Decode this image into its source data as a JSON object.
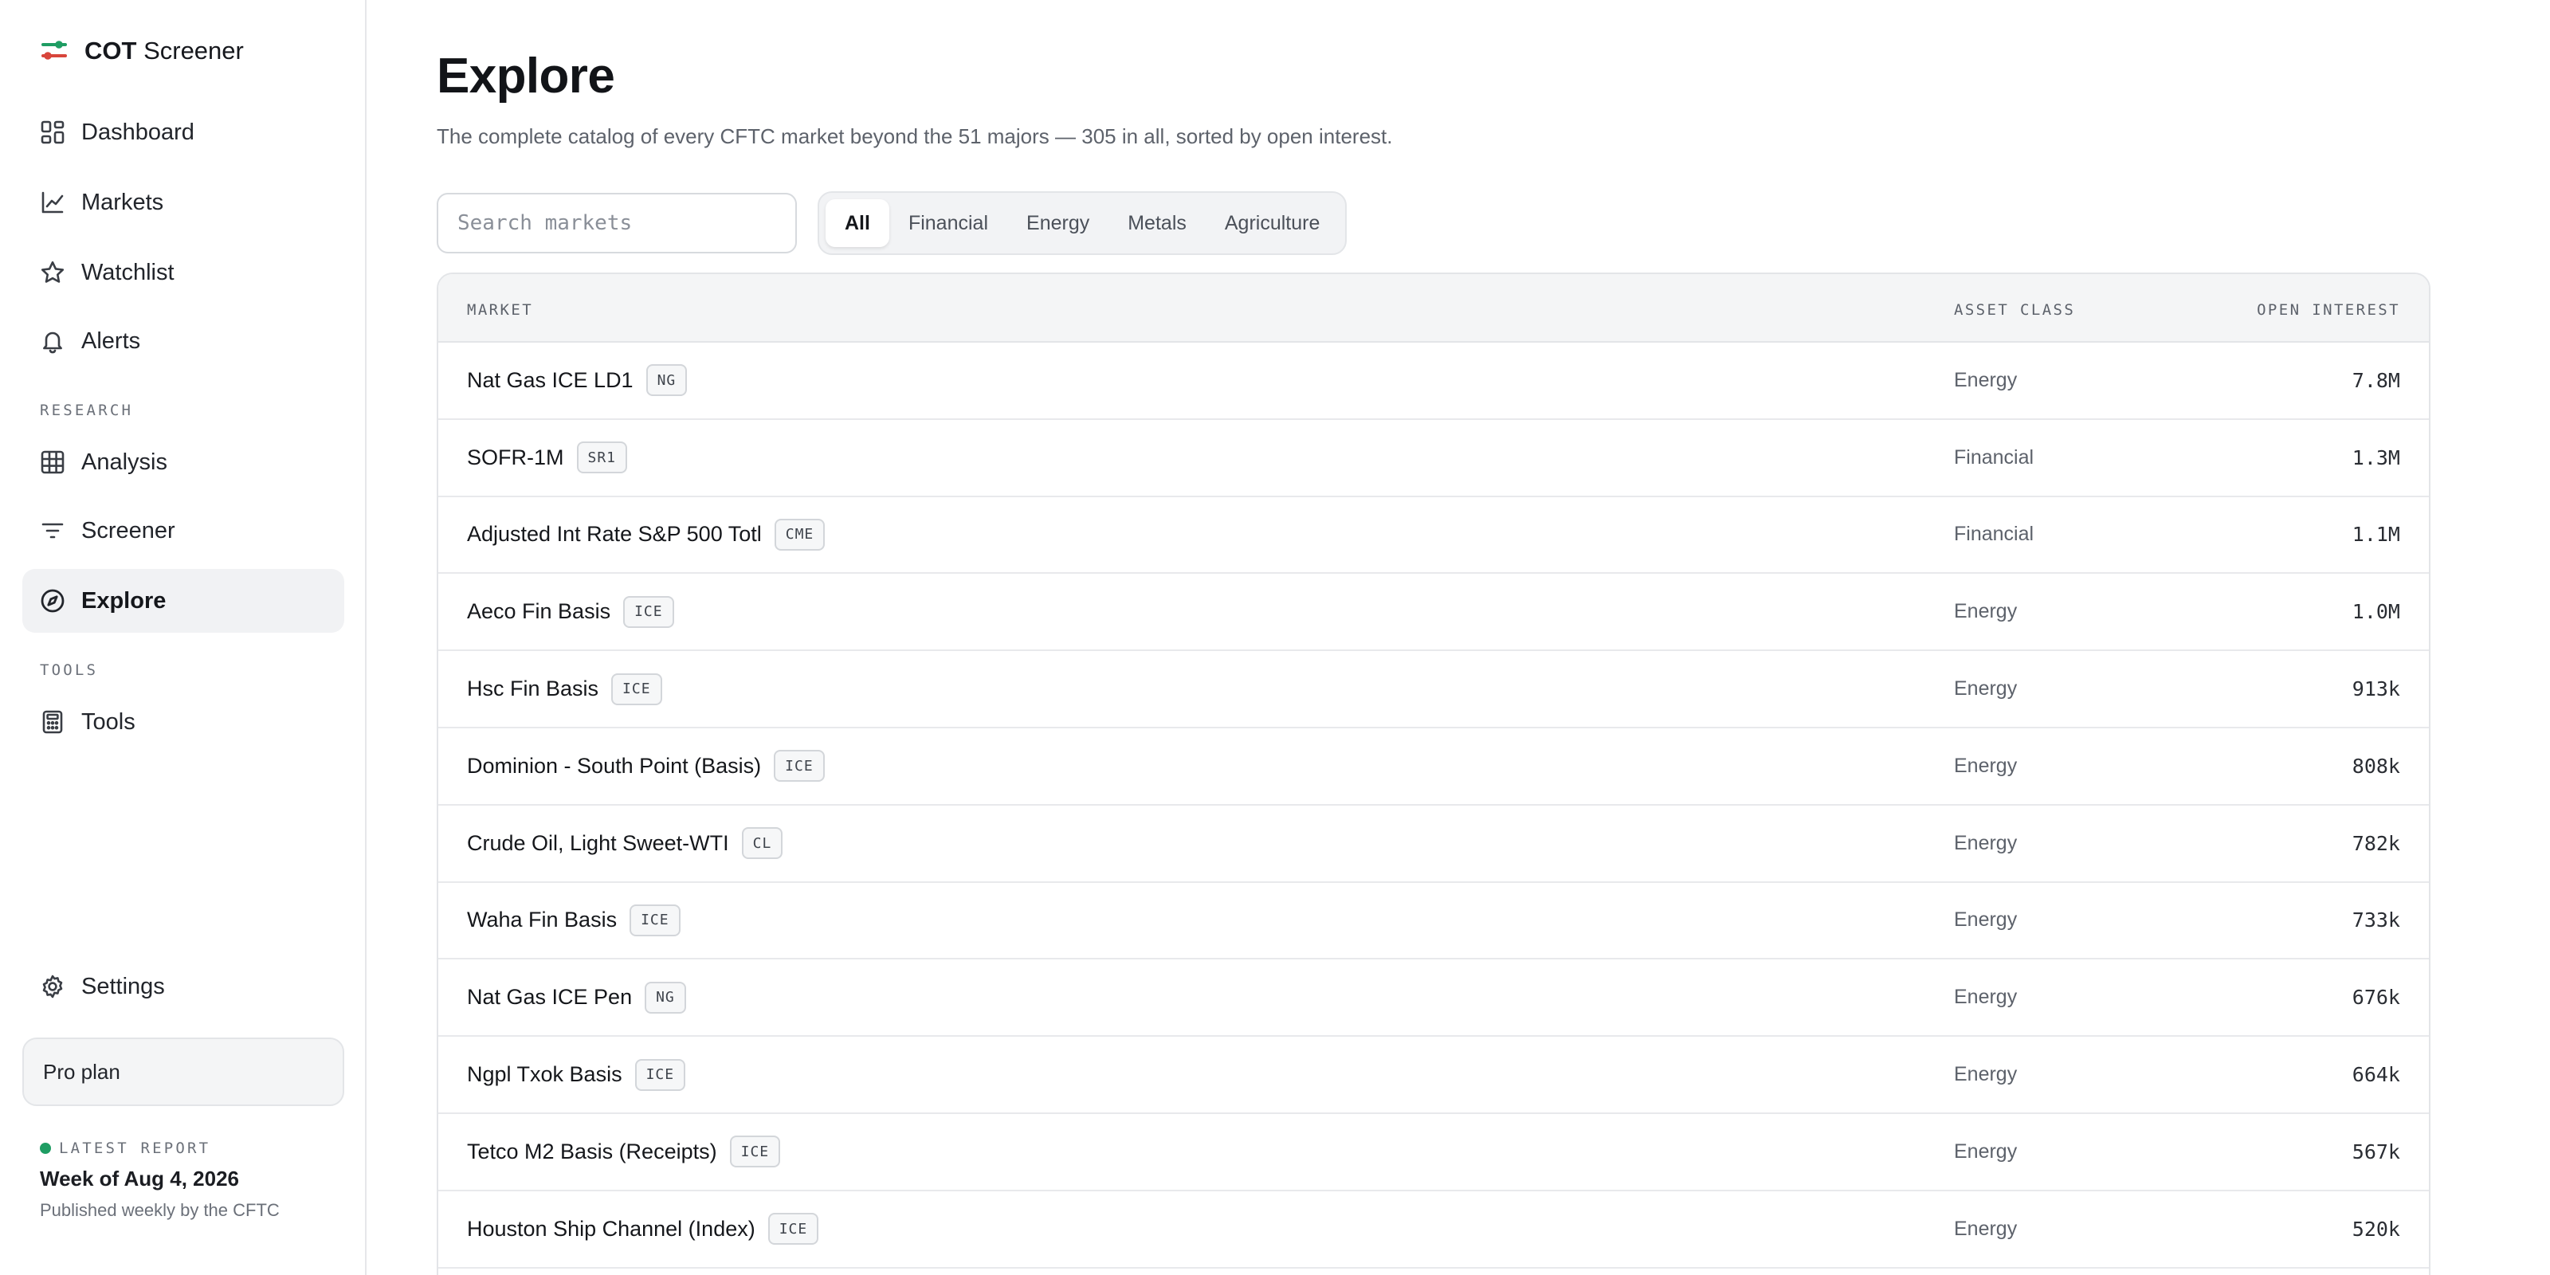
{
  "app": {
    "brand_bold": "COT",
    "brand_rest": "Screener"
  },
  "sidebar": {
    "main_items": [
      {
        "label": "Dashboard",
        "icon": "dashboard-icon"
      },
      {
        "label": "Markets",
        "icon": "line-chart-icon"
      },
      {
        "label": "Watchlist",
        "icon": "star-icon"
      },
      {
        "label": "Alerts",
        "icon": "bell-icon"
      }
    ],
    "research_label": "RESEARCH",
    "research_items": [
      {
        "label": "Analysis",
        "icon": "grid-icon"
      },
      {
        "label": "Screener",
        "icon": "filter-icon"
      },
      {
        "label": "Explore",
        "icon": "compass-icon",
        "active": true
      }
    ],
    "tools_label": "TOOLS",
    "tools_items": [
      {
        "label": "Tools",
        "icon": "calculator-icon"
      }
    ],
    "settings_label": "Settings",
    "plan_label": "Pro plan",
    "report": {
      "label": "LATEST REPORT",
      "week": "Week of Aug 4, 2026",
      "published": "Published weekly by the CFTC"
    }
  },
  "main": {
    "title": "Explore",
    "subtitle": "The complete catalog of every CFTC market beyond the 51 majors — 305 in all, sorted by open interest.",
    "search_placeholder": "Search markets",
    "filters": [
      "All",
      "Financial",
      "Energy",
      "Metals",
      "Agriculture"
    ],
    "active_filter": "All",
    "table": {
      "headers": {
        "market": "MARKET",
        "asset_class": "ASSET CLASS",
        "open_interest": "OPEN INTEREST"
      },
      "rows": [
        {
          "market": "Nat Gas ICE LD1",
          "tag": "NG",
          "asset_class": "Energy",
          "open_interest": "7.8M"
        },
        {
          "market": "SOFR-1M",
          "tag": "SR1",
          "asset_class": "Financial",
          "open_interest": "1.3M"
        },
        {
          "market": "Adjusted Int Rate S&P 500 Totl",
          "tag": "CME",
          "asset_class": "Financial",
          "open_interest": "1.1M"
        },
        {
          "market": "Aeco Fin Basis",
          "tag": "ICE",
          "asset_class": "Energy",
          "open_interest": "1.0M"
        },
        {
          "market": "Hsc Fin Basis",
          "tag": "ICE",
          "asset_class": "Energy",
          "open_interest": "913k"
        },
        {
          "market": "Dominion - South Point (Basis)",
          "tag": "ICE",
          "asset_class": "Energy",
          "open_interest": "808k"
        },
        {
          "market": "Crude Oil, Light Sweet-WTI",
          "tag": "CL",
          "asset_class": "Energy",
          "open_interest": "782k"
        },
        {
          "market": "Waha Fin Basis",
          "tag": "ICE",
          "asset_class": "Energy",
          "open_interest": "733k"
        },
        {
          "market": "Nat Gas ICE Pen",
          "tag": "NG",
          "asset_class": "Energy",
          "open_interest": "676k"
        },
        {
          "market": "Ngpl Txok Basis",
          "tag": "ICE",
          "asset_class": "Energy",
          "open_interest": "664k"
        },
        {
          "market": "Tetco M2 Basis (Receipts)",
          "tag": "ICE",
          "asset_class": "Energy",
          "open_interest": "567k"
        },
        {
          "market": "Houston Ship Channel (Index)",
          "tag": "ICE",
          "asset_class": "Energy",
          "open_interest": "520k"
        }
      ]
    }
  },
  "colors": {
    "brand_red": "#d8453b",
    "brand_green": "#1f9d63",
    "active_nav_bg": "#f1f2f4",
    "report_dot": "#1f9d63"
  }
}
